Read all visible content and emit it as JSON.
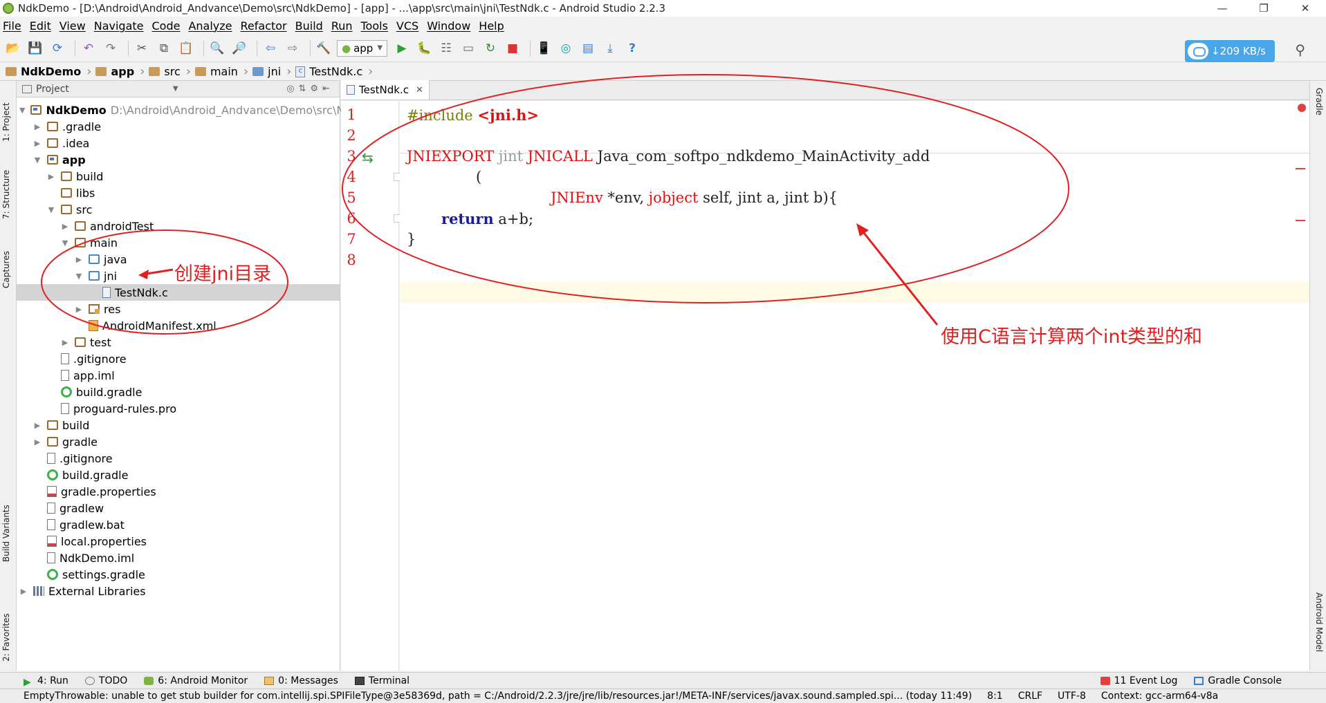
{
  "window": {
    "title": "NdkDemo - [D:\\Android\\Android_Andvance\\Demo\\src\\NdkDemo] - [app] - ...\\app\\src\\main\\jni\\TestNdk.c - Android Studio 2.2.3",
    "minimize": "—",
    "maximize": "❐",
    "close": "✕"
  },
  "menu": [
    "File",
    "Edit",
    "View",
    "Navigate",
    "Code",
    "Analyze",
    "Refactor",
    "Build",
    "Run",
    "Tools",
    "VCS",
    "Window",
    "Help"
  ],
  "toolbar": {
    "run_config": "app",
    "net_speed": "↓209 KB/s"
  },
  "breadcrumb": [
    "NdkDemo",
    "app",
    "src",
    "main",
    "jni",
    "TestNdk.c"
  ],
  "project_panel": {
    "header": "Project",
    "tree": [
      {
        "label": "NdkDemo",
        "path": "D:\\Android\\Android_Andvance\\Demo\\src\\Nd",
        "depth": 0,
        "icon": "module",
        "expanded": true,
        "bold": true
      },
      {
        "label": ".gradle",
        "depth": 1,
        "icon": "folder",
        "expanded": false
      },
      {
        "label": ".idea",
        "depth": 1,
        "icon": "folder",
        "expanded": false
      },
      {
        "label": "app",
        "depth": 1,
        "icon": "module",
        "expanded": true,
        "bold": true
      },
      {
        "label": "build",
        "depth": 2,
        "icon": "folder",
        "expanded": false
      },
      {
        "label": "libs",
        "depth": 2,
        "icon": "folder",
        "leaf": true
      },
      {
        "label": "src",
        "depth": 2,
        "icon": "folder",
        "expanded": true
      },
      {
        "label": "androidTest",
        "depth": 3,
        "icon": "folder",
        "expanded": false
      },
      {
        "label": "main",
        "depth": 3,
        "icon": "folder",
        "expanded": true
      },
      {
        "label": "java",
        "depth": 4,
        "icon": "src",
        "expanded": false
      },
      {
        "label": "jni",
        "depth": 4,
        "icon": "src",
        "expanded": true
      },
      {
        "label": "TestNdk.c",
        "depth": 5,
        "icon": "cfile",
        "leaf": true,
        "selected": true
      },
      {
        "label": "res",
        "depth": 4,
        "icon": "res",
        "expanded": false
      },
      {
        "label": "AndroidManifest.xml",
        "depth": 4,
        "icon": "xml",
        "leaf": true
      },
      {
        "label": "test",
        "depth": 3,
        "icon": "folder",
        "expanded": false
      },
      {
        "label": ".gitignore",
        "depth": 2,
        "icon": "file",
        "leaf": true
      },
      {
        "label": "app.iml",
        "depth": 2,
        "icon": "file",
        "leaf": true
      },
      {
        "label": "build.gradle",
        "depth": 2,
        "icon": "gradle",
        "leaf": true
      },
      {
        "label": "proguard-rules.pro",
        "depth": 2,
        "icon": "file",
        "leaf": true
      },
      {
        "label": "build",
        "depth": 1,
        "icon": "folder",
        "expanded": false
      },
      {
        "label": "gradle",
        "depth": 1,
        "icon": "folder",
        "expanded": false
      },
      {
        "label": ".gitignore",
        "depth": 1,
        "icon": "file",
        "leaf": true
      },
      {
        "label": "build.gradle",
        "depth": 1,
        "icon": "gradle",
        "leaf": true
      },
      {
        "label": "gradle.properties",
        "depth": 1,
        "icon": "prop",
        "leaf": true
      },
      {
        "label": "gradlew",
        "depth": 1,
        "icon": "file",
        "leaf": true
      },
      {
        "label": "gradlew.bat",
        "depth": 1,
        "icon": "file",
        "leaf": true
      },
      {
        "label": "local.properties",
        "depth": 1,
        "icon": "prop",
        "leaf": true
      },
      {
        "label": "NdkDemo.iml",
        "depth": 1,
        "icon": "file",
        "leaf": true
      },
      {
        "label": "settings.gradle",
        "depth": 1,
        "icon": "gradle",
        "leaf": true
      },
      {
        "label": "External Libraries",
        "depth": 0,
        "icon": "lib",
        "expanded": false
      }
    ]
  },
  "editor": {
    "tab": "TestNdk.c",
    "line_numbers": [
      "1",
      "2",
      "3",
      "4",
      "5",
      "6",
      "7",
      "8"
    ],
    "lines": {
      "l1_hash": "#include ",
      "l1_path": "<jni.h>",
      "l3_a": "JNIEXPORT",
      "l3_b": "jint",
      "l3_c": "JNICALL",
      "l3_d": "Java_com_softpo_ndkdemo_MainActivity_add",
      "l4": "(",
      "l5_a": "JNIEnv",
      "l5_b": " *env, ",
      "l5_c": "jobject",
      "l5_d": " self, ",
      "l5_e": "jint",
      "l5_f": " a, ",
      "l5_g": "jint",
      "l5_h": " b){",
      "l6_kw": "return",
      "l6_rest": " a+b;",
      "l7": "}"
    }
  },
  "annotations": {
    "jni_note": "创建jni目录",
    "code_note": "使用C语言计算两个int类型的和"
  },
  "side_tabs": {
    "left": [
      "1: Project",
      "7: Structure",
      "Captures",
      "Build Variants",
      "2: Favorites"
    ],
    "right": [
      "Gradle",
      "Android Model"
    ]
  },
  "bottom_tabs": {
    "left": [
      "4: Run",
      "TODO",
      "6: Android Monitor",
      "0: Messages",
      "Terminal"
    ],
    "right": [
      "11 Event Log",
      "Gradle Console"
    ]
  },
  "status": {
    "message": "EmptyThrowable: unable to get stub builder for com.intellij.spi.SPIFileType@3e58369d, path = C:/Android/2.2.3/jre/jre/lib/resources.jar!/META-INF/services/javax.sound.sampled.spi... (today 11:49)",
    "position": "8:1",
    "line_sep": "CRLF",
    "encoding": "UTF-8",
    "context": "Context: gcc-arm64-v8a"
  },
  "colors": {
    "annotation": "#e02020",
    "keyword_red": "#d11111",
    "accent_blue": "#49a6e8"
  }
}
